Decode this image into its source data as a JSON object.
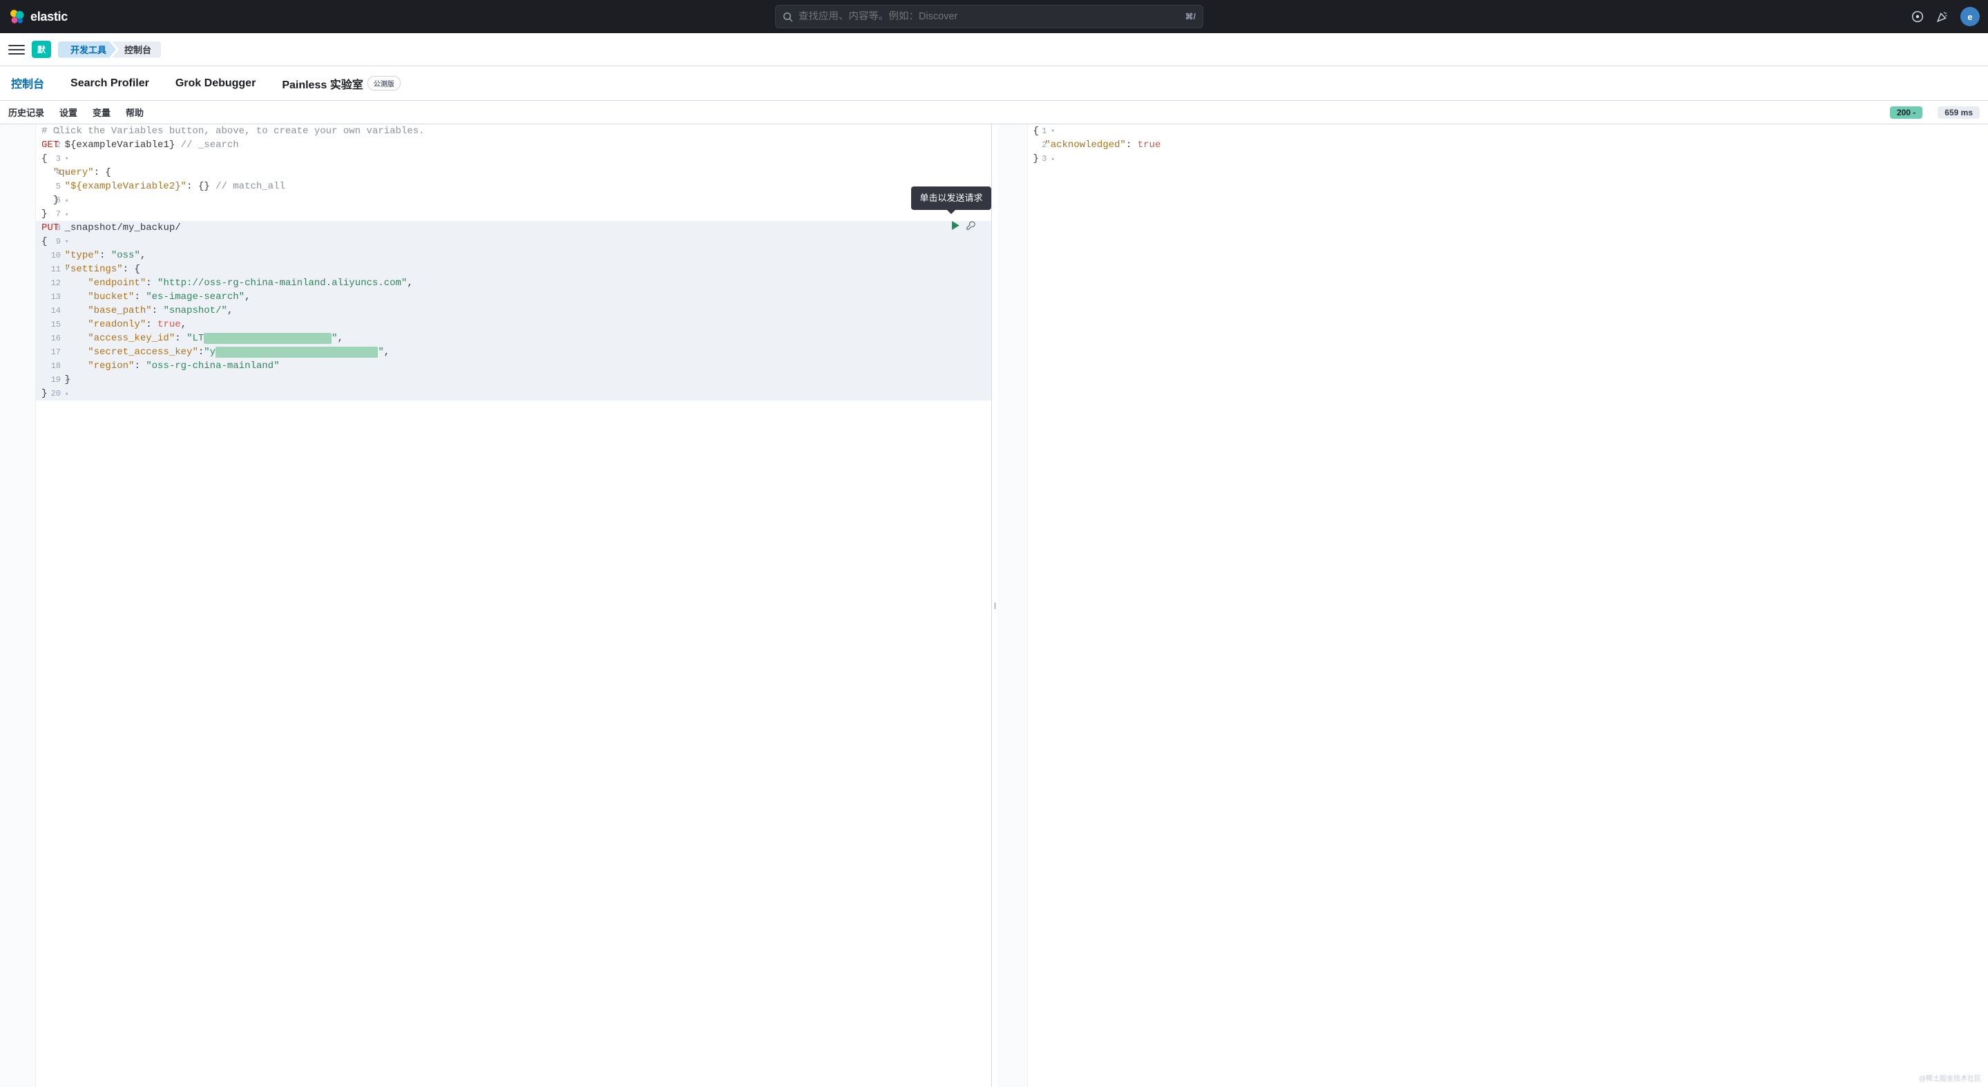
{
  "header": {
    "brand": "elastic",
    "search_placeholder": "查找应用、内容等。例如：Discover",
    "shortcut": "⌘/",
    "avatar_initial": "e"
  },
  "breadcrumb": {
    "default_badge": "默",
    "items": [
      "开发工具",
      "控制台"
    ]
  },
  "tabs": [
    {
      "label": "控制台",
      "active": true
    },
    {
      "label": "Search Profiler",
      "active": false
    },
    {
      "label": "Grok Debugger",
      "active": false
    },
    {
      "label": "Painless 实验室",
      "active": false,
      "beta": "公测版"
    }
  ],
  "toolbar": {
    "history": "历史记录",
    "settings": "设置",
    "variables": "变量",
    "help": "帮助",
    "status_code": "200 -",
    "latency": "659 ms"
  },
  "tooltip": "单击以发送请求",
  "request_lines": [
    {
      "n": 1,
      "fold": "",
      "hl": false,
      "tokens": [
        [
          "c-comment",
          "# Click the Variables button, above, to create your own variables."
        ]
      ]
    },
    {
      "n": 2,
      "fold": "",
      "hl": false,
      "tokens": [
        [
          "c-method-get",
          "GET"
        ],
        [
          "",
          " "
        ],
        [
          "c-var",
          "${exampleVariable1}"
        ],
        [
          "",
          " "
        ],
        [
          "c-comment",
          "// _search"
        ]
      ]
    },
    {
      "n": 3,
      "fold": "▾",
      "hl": false,
      "tokens": [
        [
          "c-punct",
          "{"
        ]
      ]
    },
    {
      "n": 4,
      "fold": "▾",
      "hl": false,
      "tokens": [
        [
          "",
          "  "
        ],
        [
          "c-key",
          "\"query\""
        ],
        [
          "c-punct",
          ": {"
        ]
      ]
    },
    {
      "n": 5,
      "fold": "",
      "hl": false,
      "tokens": [
        [
          "",
          "    "
        ],
        [
          "c-key",
          "\"${exampleVariable2}\""
        ],
        [
          "c-punct",
          ": {} "
        ],
        [
          "c-comment",
          "// match_all"
        ]
      ]
    },
    {
      "n": 6,
      "fold": "▴",
      "hl": false,
      "tokens": [
        [
          "",
          "  "
        ],
        [
          "c-punct",
          "}"
        ]
      ]
    },
    {
      "n": 7,
      "fold": "▴",
      "hl": false,
      "tokens": [
        [
          "c-punct",
          "}"
        ]
      ]
    },
    {
      "n": 8,
      "fold": "",
      "hl": true,
      "tokens": [
        [
          "c-method-put",
          "PUT"
        ],
        [
          "",
          " "
        ],
        [
          "c-var",
          "_snapshot/my_backup/"
        ]
      ]
    },
    {
      "n": 9,
      "fold": "▾",
      "hl": true,
      "tokens": [
        [
          "c-punct",
          "{"
        ]
      ]
    },
    {
      "n": 10,
      "fold": "",
      "hl": true,
      "tokens": [
        [
          "",
          "    "
        ],
        [
          "c-key",
          "\"type\""
        ],
        [
          "c-punct",
          ": "
        ],
        [
          "c-string",
          "\"oss\""
        ],
        [
          "c-punct",
          ","
        ]
      ]
    },
    {
      "n": 11,
      "fold": "▾",
      "hl": true,
      "tokens": [
        [
          "",
          "    "
        ],
        [
          "c-key",
          "\"settings\""
        ],
        [
          "c-punct",
          ": {"
        ]
      ]
    },
    {
      "n": 12,
      "fold": "",
      "hl": true,
      "tokens": [
        [
          "",
          "        "
        ],
        [
          "c-key",
          "\"endpoint\""
        ],
        [
          "c-punct",
          ": "
        ],
        [
          "c-string",
          "\"http://oss-rg-china-mainland.aliyuncs.com\""
        ],
        [
          "c-punct",
          ","
        ]
      ]
    },
    {
      "n": 13,
      "fold": "",
      "hl": true,
      "tokens": [
        [
          "",
          "        "
        ],
        [
          "c-key",
          "\"bucket\""
        ],
        [
          "c-punct",
          ": "
        ],
        [
          "c-string",
          "\"es-image-search\""
        ],
        [
          "c-punct",
          ","
        ]
      ]
    },
    {
      "n": 14,
      "fold": "",
      "hl": true,
      "tokens": [
        [
          "",
          "        "
        ],
        [
          "c-key",
          "\"base_path\""
        ],
        [
          "c-punct",
          ": "
        ],
        [
          "c-string",
          "\"snapshot/\""
        ],
        [
          "c-punct",
          ","
        ]
      ]
    },
    {
      "n": 15,
      "fold": "",
      "hl": true,
      "tokens": [
        [
          "",
          "        "
        ],
        [
          "c-key",
          "\"readonly\""
        ],
        [
          "c-punct",
          ": "
        ],
        [
          "c-bool",
          "true"
        ],
        [
          "c-punct",
          ","
        ]
      ]
    },
    {
      "n": 16,
      "fold": "",
      "hl": true,
      "tokens": [
        [
          "",
          "        "
        ],
        [
          "c-key",
          "\"access_key_id\""
        ],
        [
          "c-punct",
          ": "
        ],
        [
          "c-string",
          "\"LT"
        ],
        [
          "redact",
          "XXXXXXXXXXXXXXXXXXXXXX"
        ],
        [
          "c-string",
          "\""
        ],
        [
          "c-punct",
          ","
        ]
      ]
    },
    {
      "n": 17,
      "fold": "",
      "hl": true,
      "tokens": [
        [
          "",
          "        "
        ],
        [
          "c-key",
          "\"secret_access_key\""
        ],
        [
          "c-punct",
          ":"
        ],
        [
          "c-string",
          "\"y"
        ],
        [
          "redact",
          "XXXXXXXXXXXXXXXXXXXXXXXXXXXX"
        ],
        [
          "c-string",
          "\""
        ],
        [
          "c-punct",
          ","
        ]
      ]
    },
    {
      "n": 18,
      "fold": "",
      "hl": true,
      "tokens": [
        [
          "",
          "        "
        ],
        [
          "c-key",
          "\"region\""
        ],
        [
          "c-punct",
          ": "
        ],
        [
          "c-string",
          "\"oss-rg-china-mainland\""
        ]
      ]
    },
    {
      "n": 19,
      "fold": "▴",
      "hl": true,
      "tokens": [
        [
          "",
          "    "
        ],
        [
          "c-punct",
          "}"
        ]
      ]
    },
    {
      "n": 20,
      "fold": "▴",
      "hl": true,
      "tokens": [
        [
          "c-punct",
          "}"
        ]
      ]
    }
  ],
  "response_lines": [
    {
      "n": 1,
      "fold": "▾",
      "tokens": [
        [
          "c-punct",
          "{"
        ]
      ]
    },
    {
      "n": 2,
      "fold": "",
      "tokens": [
        [
          "",
          "  "
        ],
        [
          "c-key",
          "\"acknowledged\""
        ],
        [
          "c-punct",
          ": "
        ],
        [
          "c-bool",
          "true"
        ]
      ]
    },
    {
      "n": 3,
      "fold": "▴",
      "tokens": [
        [
          "c-punct",
          "}"
        ]
      ]
    }
  ],
  "watermark": "@稀土掘金技术社区"
}
